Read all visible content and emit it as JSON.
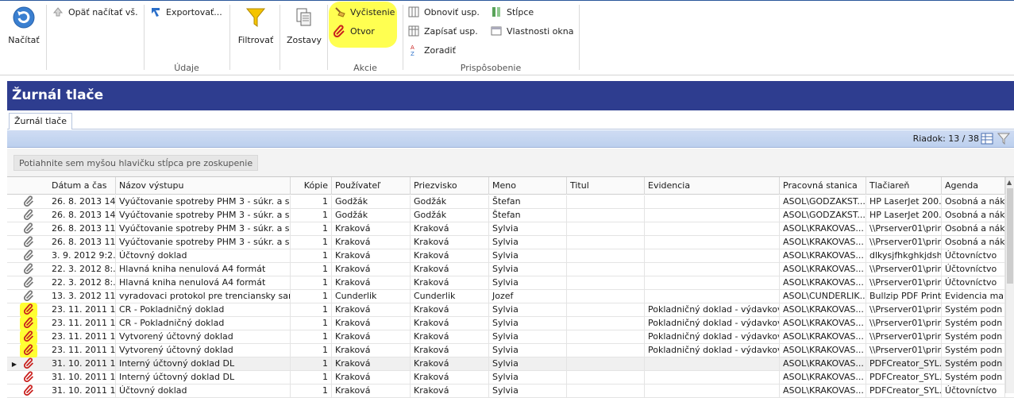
{
  "ribbon": {
    "load_label": "Načítať",
    "reload_label": "Opäť načítať vš.",
    "export_label": "Exportovať...",
    "filter_label": "Filtrovať",
    "reports_label": "Zostavy",
    "clean_label": "Vyčistenie",
    "open_label": "Otvor",
    "restore_label": "Obnoviť usp.",
    "save_label": "Zapísať usp.",
    "sort_label": "Zoradiť",
    "columns_label": "Stĺpce",
    "window_props_label": "Vlastnosti okna",
    "group_data": "Údaje",
    "group_actions": "Akcie",
    "group_customize": "Prispôsobenie"
  },
  "page_title": "Žurnál tlače",
  "tab_label": "Žurnál tlače",
  "row_counter": "Riadok: 13 / 38",
  "group_hint": "Potiahnite sem myšou hlavičku stĺpca pre zoskupenie",
  "columns": [
    "Dátum a čas",
    "Názov výstupu",
    "Kópie",
    "Používateľ",
    "Priezvisko",
    "Meno",
    "Titul",
    "Evidencia",
    "Pracovná stanica",
    "Tlačiareň",
    "Agenda"
  ],
  "rows": [
    {
      "date": "26. 8. 2013 14...",
      "name": "Vyúčtovanie spotreby PHM 3 - súkr. a slu...",
      "copies": "1",
      "user": "Godžák",
      "surname": "Godžák",
      "first": "Štefan",
      "title": "",
      "evid": "",
      "station": "ASOL\\GODZAKST...",
      "printer": "HP LaserJet 200...",
      "agenda": "Osobná a nák",
      "icon": "paperclip",
      "hl": false,
      "sel": false
    },
    {
      "date": "26. 8. 2013 14...",
      "name": "Vyúčtovanie spotreby PHM 3 - súkr. a slu...",
      "copies": "1",
      "user": "Godžák",
      "surname": "Godžák",
      "first": "Štefan",
      "title": "",
      "evid": "",
      "station": "ASOL\\GODZAKST...",
      "printer": "HP LaserJet 200...",
      "agenda": "Osobná a nák",
      "icon": "paperclip",
      "hl": false,
      "sel": false
    },
    {
      "date": "26. 8. 2013 11...",
      "name": "Vyúčtovanie spotreby PHM 3 - súkr. a slu...",
      "copies": "1",
      "user": "Kraková",
      "surname": "Kraková",
      "first": "Sylvia",
      "title": "",
      "evid": "",
      "station": "ASOL\\KRAKOVAS...",
      "printer": "\\\\Prserver01\\print...",
      "agenda": "Osobná a nák",
      "icon": "paperclip",
      "hl": false,
      "sel": false
    },
    {
      "date": "26. 8. 2013 11...",
      "name": "Vyúčtovanie spotreby PHM 3 - súkr. a slu...",
      "copies": "1",
      "user": "Kraková",
      "surname": "Kraková",
      "first": "Sylvia",
      "title": "",
      "evid": "",
      "station": "ASOL\\KRAKOVAS...",
      "printer": "\\\\Prserver01\\print...",
      "agenda": "Osobná a nák",
      "icon": "paperclip",
      "hl": false,
      "sel": false
    },
    {
      "date": "3. 9. 2012 9:2...",
      "name": "Účtovný doklad",
      "copies": "1",
      "user": "Kraková",
      "surname": "Kraková",
      "first": "Sylvia",
      "title": "",
      "evid": "",
      "station": "ASOL\\KRAKOVAS...",
      "printer": "dlkysjfhkghkjdshf...",
      "agenda": "Účtovníctvo",
      "icon": "paperclip",
      "hl": false,
      "sel": false
    },
    {
      "date": "22. 3. 2012 8:...",
      "name": "Hlavná kniha nenulová A4 formát",
      "copies": "1",
      "user": "Kraková",
      "surname": "Kraková",
      "first": "Sylvia",
      "title": "",
      "evid": "",
      "station": "ASOL\\KRAKOVAS...",
      "printer": "\\\\Prserver01\\print...",
      "agenda": "Účtovníctvo",
      "icon": "paperclip",
      "hl": false,
      "sel": false
    },
    {
      "date": "22. 3. 2012 8:...",
      "name": "Hlavná kniha nenulová A4 formát",
      "copies": "1",
      "user": "Kraková",
      "surname": "Kraková",
      "first": "Sylvia",
      "title": "",
      "evid": "",
      "station": "ASOL\\KRAKOVAS...",
      "printer": "\\\\Prserver01\\print...",
      "agenda": "Účtovníctvo",
      "icon": "paperclip",
      "hl": false,
      "sel": false
    },
    {
      "date": "13. 3. 2012 11...",
      "name": "vyradovaci protokol pre trenciansky sam...",
      "copies": "1",
      "user": "Cunderlik",
      "surname": "Cunderlik",
      "first": "Jozef",
      "title": "",
      "evid": "",
      "station": "ASOL\\CUNDERLIK...",
      "printer": "Bullzip PDF Print...",
      "agenda": "Evidencia ma",
      "icon": "paperclip",
      "hl": false,
      "sel": false
    },
    {
      "date": "23. 11. 2011 1...",
      "name": "CR - Pokladničný doklad",
      "copies": "1",
      "user": "Kraková",
      "surname": "Kraková",
      "first": "Sylvia",
      "title": "",
      "evid": "Pokladničný doklad - výdavkový",
      "station": "ASOL\\KRAKOVAS...",
      "printer": "\\\\Prserver01\\print...",
      "agenda": "Systém podn",
      "icon": "redclip",
      "hl": true,
      "sel": false
    },
    {
      "date": "23. 11. 2011 1...",
      "name": "CR - Pokladničný doklad",
      "copies": "1",
      "user": "Kraková",
      "surname": "Kraková",
      "first": "Sylvia",
      "title": "",
      "evid": "Pokladničný doklad - výdavkový",
      "station": "ASOL\\KRAKOVAS...",
      "printer": "\\\\Prserver01\\print...",
      "agenda": "Systém podn",
      "icon": "redclip",
      "hl": true,
      "sel": false
    },
    {
      "date": "23. 11. 2011 1...",
      "name": "Vytvorený účtovný doklad",
      "copies": "1",
      "user": "Kraková",
      "surname": "Kraková",
      "first": "Sylvia",
      "title": "",
      "evid": "Pokladničný doklad - výdavkový",
      "station": "ASOL\\KRAKOVAS...",
      "printer": "\\\\Prserver01\\print...",
      "agenda": "Systém podn",
      "icon": "redclip",
      "hl": true,
      "sel": false
    },
    {
      "date": "23. 11. 2011 1...",
      "name": "Vytvorený účtovný doklad",
      "copies": "1",
      "user": "Kraková",
      "surname": "Kraková",
      "first": "Sylvia",
      "title": "",
      "evid": "Pokladničný doklad - výdavkový",
      "station": "ASOL\\KRAKOVAS...",
      "printer": "\\\\Prserver01\\print...",
      "agenda": "Systém podn",
      "icon": "redclip",
      "hl": true,
      "sel": false
    },
    {
      "date": "31. 10. 2011 1...",
      "name": "Interný účtovný doklad DL",
      "copies": "1",
      "user": "Kraková",
      "surname": "Kraková",
      "first": "Sylvia",
      "title": "",
      "evid": "",
      "station": "ASOL\\KRAKOVAS...",
      "printer": "PDFCreator_SYL...",
      "agenda": "Systém podn",
      "icon": "redclip",
      "hl": false,
      "sel": true
    },
    {
      "date": "31. 10. 2011 1...",
      "name": "Interný účtovný doklad DL",
      "copies": "1",
      "user": "Kraková",
      "surname": "Kraková",
      "first": "Sylvia",
      "title": "",
      "evid": "",
      "station": "ASOL\\KRAKOVAS...",
      "printer": "PDFCreator_SYL...",
      "agenda": "Systém podn",
      "icon": "redclip",
      "hl": false,
      "sel": false
    },
    {
      "date": "31. 10. 2011 1...",
      "name": "Účtovný doklad",
      "copies": "1",
      "user": "Kraková",
      "surname": "Kraková",
      "first": "Sylvia",
      "title": "",
      "evid": "",
      "station": "ASOL\\KRAKOVAS...",
      "printer": "PDFCreator_SYL...",
      "agenda": "Účtovníctvo",
      "icon": "redclip",
      "hl": false,
      "sel": false
    }
  ]
}
